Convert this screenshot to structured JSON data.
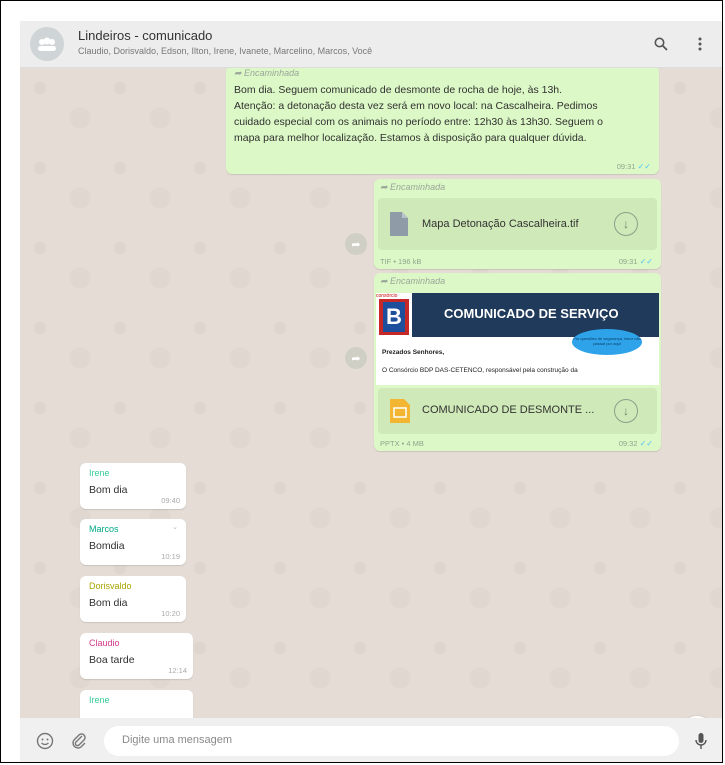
{
  "header": {
    "title": "Lindeiros - comunicado",
    "participants": "Claudio, Dorisvaldo, Edson, Ilton, Irene, Ivanete, Marcelino, Marcos, Você",
    "avatar_icon": "group-avatar-icon",
    "search_icon": "search-icon",
    "menu_icon": "kebab-menu-icon"
  },
  "messages": {
    "announcement": {
      "forwarded_label": "Encaminhada",
      "text_line1": "Bom dia. Seguem comunicado de desmonte de rocha de hoje, às 13h.",
      "text_line2": "Atenção: a detonação desta vez será em novo local: na Cascalheira. Pedimos",
      "text_line3": "cuidado especial com os animais no período entre: 12h30 às 13h30. Seguem o",
      "text_line4": "mapa para melhor localização. Estamos à disposição para qualquer dúvida.",
      "time": "09:31"
    },
    "file_tif": {
      "forwarded_label": "Encaminhada",
      "filename": "Mapa Detonação Cascalheira.tif",
      "fileinfo": "TIF • 196 kB",
      "time": "09:31"
    },
    "file_pptx": {
      "forwarded_label": "Encaminhada",
      "preview_logo_caption": "consórcio",
      "preview_logo_letter": "B",
      "preview_title": "COMUNICADO DE SERVIÇO",
      "preview_bubble": "Por questões de segurança, favor não passar por aqui",
      "preview_salutation": "Prezados Senhores,",
      "preview_body": "O Consórcio BDP DAS-CETENCO, responsável pela construção da",
      "filename": "COMUNICADO DE DESMONTE ...",
      "fileinfo": "PPTX • 4 MB",
      "time": "09:32"
    },
    "incoming": [
      {
        "sender": "Irene",
        "text": "Bom dia",
        "time": "09:40",
        "color": "#35cd96"
      },
      {
        "sender": "Marcos",
        "text": "Bomdia",
        "time": "10:19",
        "color": "#00a884"
      },
      {
        "sender": "Dorisvaldo",
        "text": "Bom dia",
        "time": "10:20",
        "color": "#a8a400"
      },
      {
        "sender": "Claudio",
        "text": "Boa tarde",
        "time": "12:14",
        "color": "#d3398a"
      },
      {
        "sender": "Irene",
        "text": "",
        "time": "",
        "color": "#35cd96"
      }
    ]
  },
  "footer": {
    "placeholder": "Digite uma mensagem",
    "emoji_icon": "emoji-icon",
    "attach_icon": "paperclip-icon",
    "mic_icon": "microphone-icon"
  },
  "colors": {
    "outgoing_bubble": "#dcf8c6",
    "incoming_bubble": "#ffffff",
    "chat_background": "#e5ddd5",
    "read_ticks": "#4fc3f7"
  }
}
